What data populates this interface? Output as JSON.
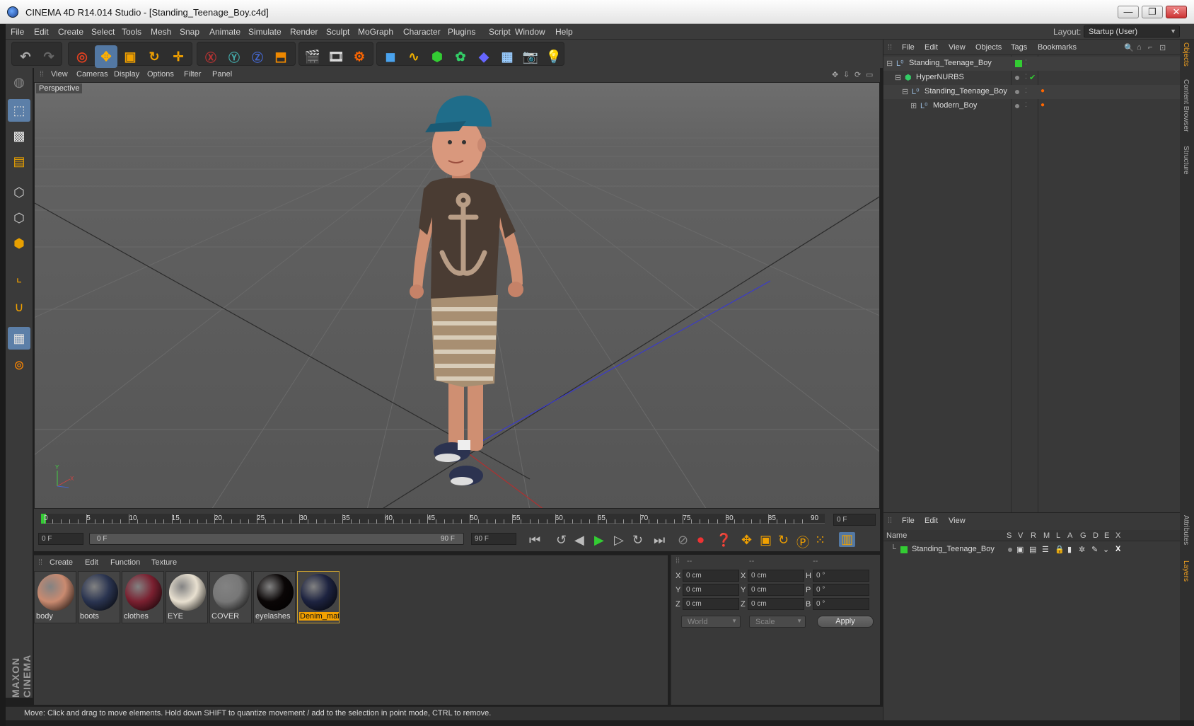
{
  "window": {
    "title": "CINEMA 4D R14.014 Studio - [Standing_Teenage_Boy.c4d]",
    "controls": [
      "—",
      "❐",
      "✕"
    ]
  },
  "menubar": {
    "items": [
      "File",
      "Edit",
      "Create",
      "Select",
      "Tools",
      "Mesh",
      "Snap",
      "Animate",
      "Simulate",
      "Render",
      "Sculpt",
      "MoGraph",
      "Character",
      "Plugins",
      "Script",
      "Window",
      "Help"
    ],
    "layout_label": "Layout:",
    "layout_value": "Startup (User)"
  },
  "viewport": {
    "menu": [
      "View",
      "Cameras",
      "Display",
      "Options",
      "Filter",
      "Panel"
    ],
    "camera_label": "Perspective"
  },
  "timeline": {
    "ticks": [
      "0",
      "5",
      "10",
      "15",
      "20",
      "25",
      "30",
      "35",
      "40",
      "45",
      "50",
      "55",
      "60",
      "65",
      "70",
      "75",
      "80",
      "85",
      "90"
    ],
    "current_frame": "0 F",
    "start_field": "0 F",
    "range_left": "0 F",
    "range_right": "90 F",
    "end_field": "90 F"
  },
  "materials": {
    "menu": [
      "Create",
      "Edit",
      "Function",
      "Texture"
    ],
    "items": [
      {
        "label": "body",
        "color": "#c98a70"
      },
      {
        "label": "boots",
        "color": "#2a3450"
      },
      {
        "label": "clothes",
        "color": "#7a2030"
      },
      {
        "label": "EYE",
        "color": "#e8e0d0"
      },
      {
        "label": "COVER",
        "color": "#777777"
      },
      {
        "label": "eyelashes",
        "color": "#0a0606"
      },
      {
        "label": "Denim_mat",
        "color": "#1d2340"
      }
    ]
  },
  "coordinates": {
    "headers": [
      "--",
      "--",
      "--"
    ],
    "rows": [
      {
        "a": "X",
        "av": "0 cm",
        "b": "X",
        "bv": "0 cm",
        "c": "H",
        "cv": "0 °"
      },
      {
        "a": "Y",
        "av": "0 cm",
        "b": "Y",
        "bv": "0 cm",
        "c": "P",
        "cv": "0 °"
      },
      {
        "a": "Z",
        "av": "0 cm",
        "b": "Z",
        "bv": "0 cm",
        "c": "B",
        "cv": "0 °"
      }
    ],
    "mode_world": "World",
    "mode_scale": "Scale",
    "apply": "Apply"
  },
  "object_manager": {
    "menu": [
      "File",
      "Edit",
      "View",
      "Objects",
      "Tags",
      "Bookmarks"
    ],
    "objects": [
      "Standing_Teenage_Boy",
      "HyperNURBS",
      "Standing_Teenage_Boy",
      "Modern_Boy"
    ]
  },
  "layer_manager": {
    "menu": [
      "File",
      "Edit",
      "View"
    ],
    "columns": [
      "Name",
      "S",
      "V",
      "R",
      "M",
      "L",
      "A",
      "G",
      "D",
      "E",
      "X"
    ],
    "layers": [
      "Standing_Teenage_Boy"
    ]
  },
  "right_tabs": [
    "Objects",
    "Content Browser",
    "Structure",
    "Attributes",
    "Layers"
  ],
  "status": "Move: Click and drag to move elements. Hold down SHIFT to quantize movement / add to the selection in point mode, CTRL to remove.",
  "brand": "MAXON CINEMA 4D",
  "colors": {
    "accent": "#f3a100",
    "selection": "#5378a3",
    "green_tag": "#33cc33"
  }
}
